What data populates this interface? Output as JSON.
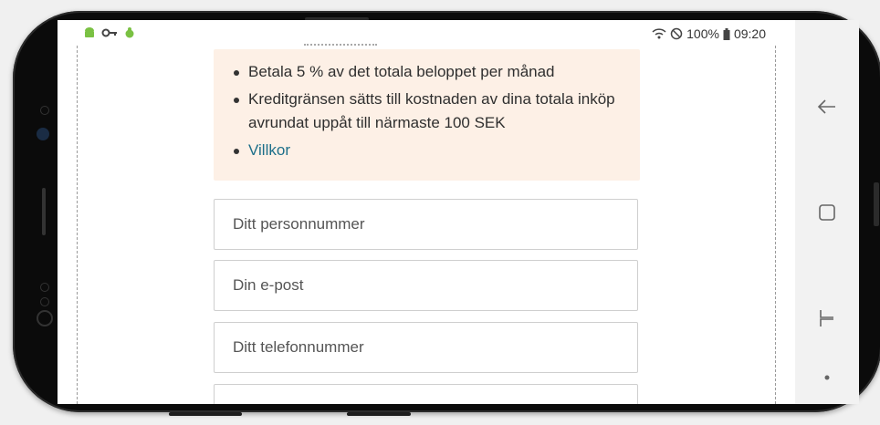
{
  "status_bar": {
    "left_icons": [
      "android-icon",
      "key-icon",
      "bug-icon"
    ],
    "battery": "100%",
    "time": "09:20"
  },
  "info": {
    "items": [
      "Betala 5 % av det totala beloppet per månad",
      "Kreditgränsen sätts till kostnaden av dina totala inköp avrundat uppåt till närmaste 100 SEK"
    ],
    "link_label": "Villkor"
  },
  "form": {
    "personnummer_placeholder": "Ditt personnummer",
    "email_placeholder": "Din e-post",
    "phone_placeholder": "Ditt telefonnummer"
  },
  "nav": {
    "back": "back-arrow-icon",
    "recents": "recents-square-icon",
    "switch": "switch-apps-icon",
    "dot": "dot-icon"
  },
  "colors": {
    "info_bg": "#fdf0e6",
    "link": "#1d6f8a",
    "frame": "#0b0b0b"
  }
}
